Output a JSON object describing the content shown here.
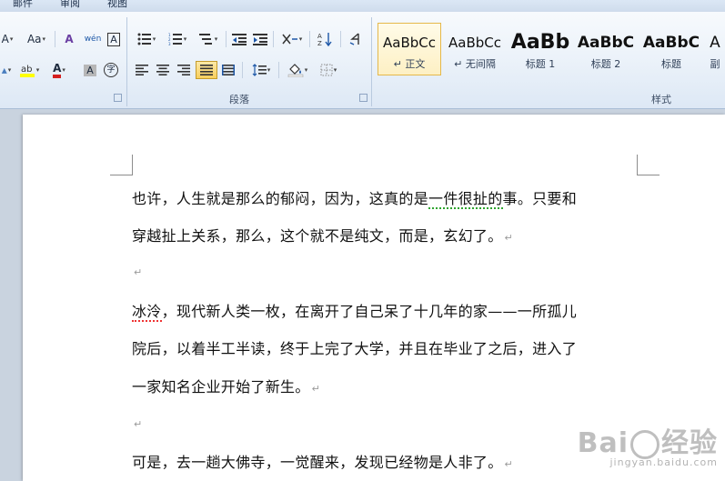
{
  "tabs": [
    "邮件",
    "审阅",
    "视图"
  ],
  "ribbon": {
    "font_group": {
      "grow_label": "A",
      "case_label": "Aa",
      "clear_format_label": "A",
      "phonetic_label": "wén",
      "border_char_label": "A",
      "font_color_label": "A",
      "shade_char_label": "A",
      "enclose_label": "字"
    },
    "paragraph_group": {
      "label": "段落"
    },
    "styles_group": {
      "label": "样式",
      "styles": [
        {
          "sample": "AaBbCc",
          "name": "↵ 正文"
        },
        {
          "sample": "AaBbCc",
          "name": "↵ 无间隔"
        },
        {
          "sample": "AaBb",
          "name": "标题 1"
        },
        {
          "sample": "AaBbC",
          "name": "标题 2"
        },
        {
          "sample": "AaBbC",
          "name": "标题"
        },
        {
          "sample": "A",
          "name": "副"
        }
      ]
    }
  },
  "document": {
    "lines": [
      {
        "pre": "也许，人生就是那么的郁闷，因为，这真的是",
        "mark": "一件很扯的",
        "post": "事。只要和"
      },
      {
        "text": "穿越扯上关系，那么，这个就不是纯文，而是，玄幻了。",
        "pilcrow": "↵"
      },
      {
        "text": "",
        "pilcrow": "↵"
      },
      {
        "mark": "冰泠",
        "post": "，现代新人类一枚，在离开了自己呆了十几年的家——一所孤儿"
      },
      {
        "text": "院后，以着半工半读，终于上完了大学，并且在毕业了之后，进入了"
      },
      {
        "text": "一家知名企业开始了新生。",
        "pilcrow": "↵"
      },
      {
        "text": "",
        "pilcrow": "↵"
      },
      {
        "text": "可是，去一趟大佛寺，一觉醒来，发现已经物是人非了。",
        "pilcrow": "↵"
      }
    ]
  },
  "watermark": {
    "brand": "Bai",
    "brand2": "经验",
    "url": "jingyan.baidu.com"
  },
  "colors": {
    "ribbon_bg": "#e9f1fa",
    "selection": "#f8cf5d",
    "font_color": "#d42020",
    "highlight": "#ffff00"
  }
}
